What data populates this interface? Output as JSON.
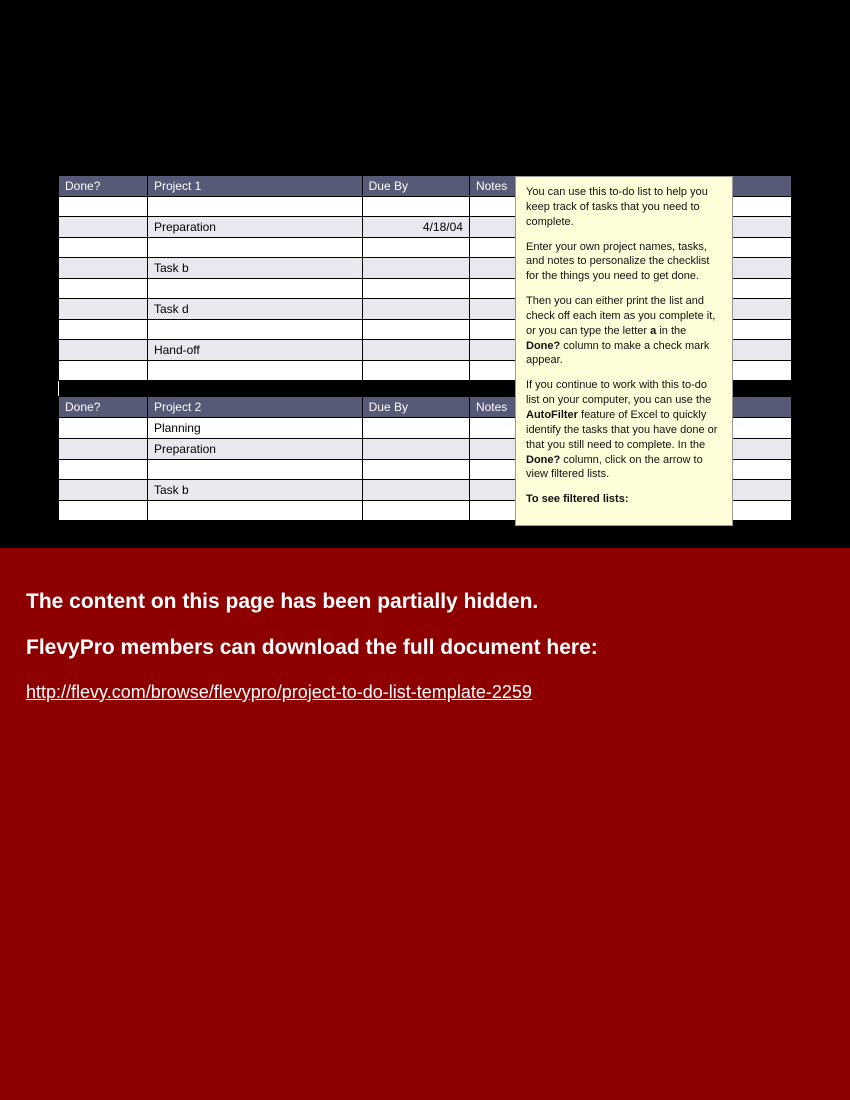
{
  "proj1": {
    "h_done": "Done?",
    "h_task": "Project 1",
    "h_due": "Due By",
    "h_notes": "Notes",
    "rows": [
      {
        "task": "",
        "due": ""
      },
      {
        "task": "Preparation",
        "due": "4/18/04"
      },
      {
        "task": "",
        "due": ""
      },
      {
        "task": "Task b",
        "due": ""
      },
      {
        "task": "",
        "due": ""
      },
      {
        "task": "Task d",
        "due": ""
      },
      {
        "task": "",
        "due": ""
      },
      {
        "task": "Hand-off",
        "due": ""
      },
      {
        "task": "",
        "due": ""
      }
    ]
  },
  "proj2": {
    "h_done": "Done?",
    "h_task": "Project 2",
    "h_due": "Due By",
    "h_notes": "Notes",
    "rows": [
      {
        "task": "Planning",
        "due": ""
      },
      {
        "task": "Preparation",
        "due": ""
      },
      {
        "task": "",
        "due": ""
      },
      {
        "task": "Task b",
        "due": ""
      },
      {
        "task": "",
        "due": ""
      }
    ]
  },
  "help": {
    "p1a": "You can use this to-do list to help you keep track of tasks that you need to complete.",
    "p2a": "Enter your own project names, tasks, and notes to personalize the checklist for the things you need to get done.",
    "p3a": "Then you can either print the list and check off each item as you complete it, or you can type the letter ",
    "p3bold1": "a",
    "p3b": " in the ",
    "p3bold2": "Done?",
    "p3c": " column to make a check mark appear.",
    "p4a": "If you continue to work with this to-do list on your computer, you can use the ",
    "p4bold1": "AutoFilter",
    "p4b": " feature of Excel to quickly identify the tasks that you have done or that you still need to complete. In the ",
    "p4bold2": "Done?",
    "p4c": " column, click on the arrow to view filtered lists.",
    "p5": "To see filtered lists:"
  },
  "overlay": {
    "line1": "The content on this page has been partially hidden.",
    "line2": "FlevyPro members can download the full document here:",
    "link": "http://flevy.com/browse/flevypro/project-to-do-list-template-2259"
  }
}
